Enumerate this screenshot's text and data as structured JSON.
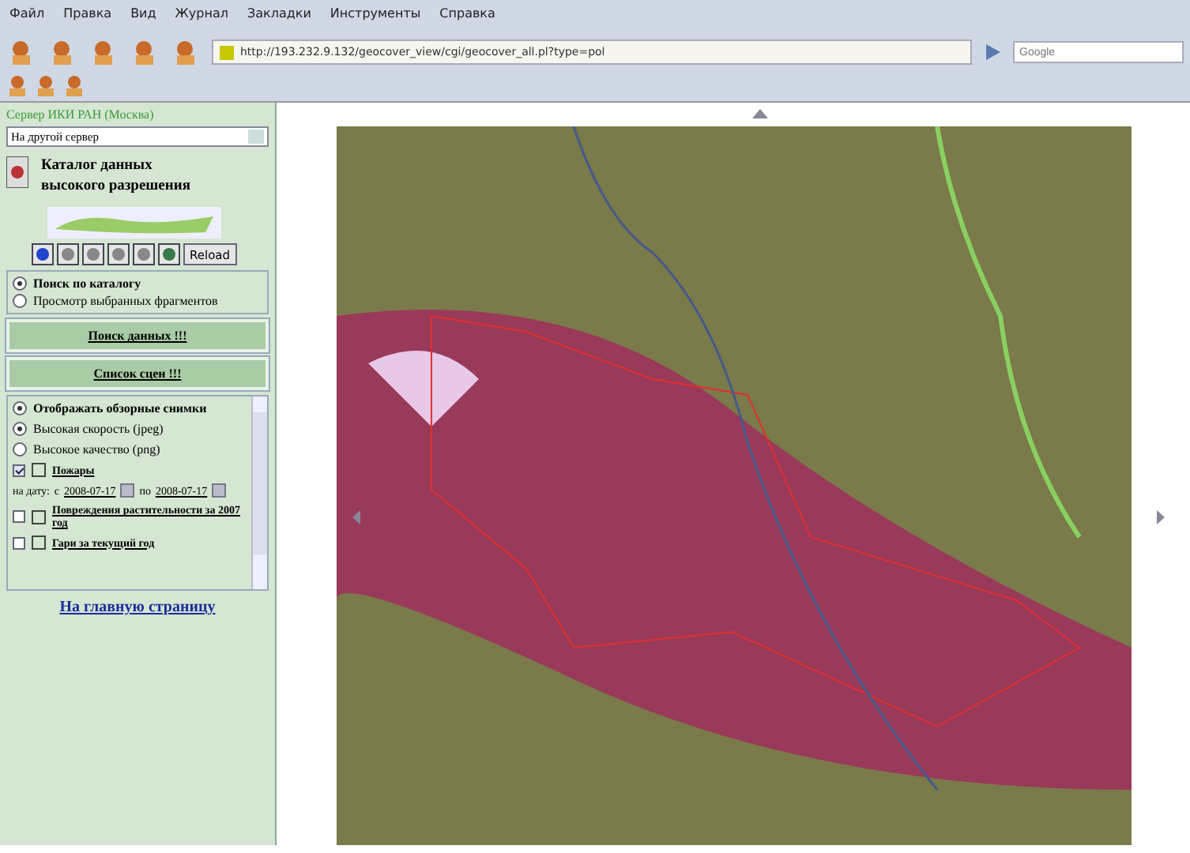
{
  "menu": [
    "Файл",
    "Правка",
    "Вид",
    "Журнал",
    "Закладки",
    "Инструменты",
    "Справка"
  ],
  "address_bar": {
    "url": "http://193.232.9.132/geocover_view/cgi/geocover_all.pl?type=pol"
  },
  "search": {
    "placeholder": "Google"
  },
  "sidebar": {
    "server_label": "Сервер ИКИ РАН (Москва)",
    "server_select": "На другой сервер",
    "title_lines": [
      "Каталог данных",
      "высокого разрешения"
    ],
    "reload_button": "Reload",
    "modes": [
      {
        "label": "Поиск по каталогу",
        "selected": true
      },
      {
        "label": "Просмотр выбранных фрагментов",
        "selected": false
      }
    ],
    "search_button": "Поиск данных !!!",
    "scenes_button": "Список сцен !!!",
    "previews": {
      "label": "Отображать обзорные снимки",
      "selected": true
    },
    "quality": [
      {
        "label": "Высокая скорость (jpeg)",
        "selected": true
      },
      {
        "label": "Высокое качество (png)",
        "selected": false
      }
    ],
    "layers": [
      {
        "kind": "dated",
        "label": "Пожары",
        "checked": true,
        "date_prefix": "на дату:",
        "from_label": "с",
        "from": "2008-07-17",
        "to_label": "по",
        "to": "2008-07-17"
      },
      {
        "kind": "plain",
        "label": "Повреждения растительности за 2007 год",
        "checked": false
      },
      {
        "kind": "plain",
        "label": "Гари за текущий год",
        "checked": false
      }
    ],
    "home_link": "На главную страницу"
  }
}
